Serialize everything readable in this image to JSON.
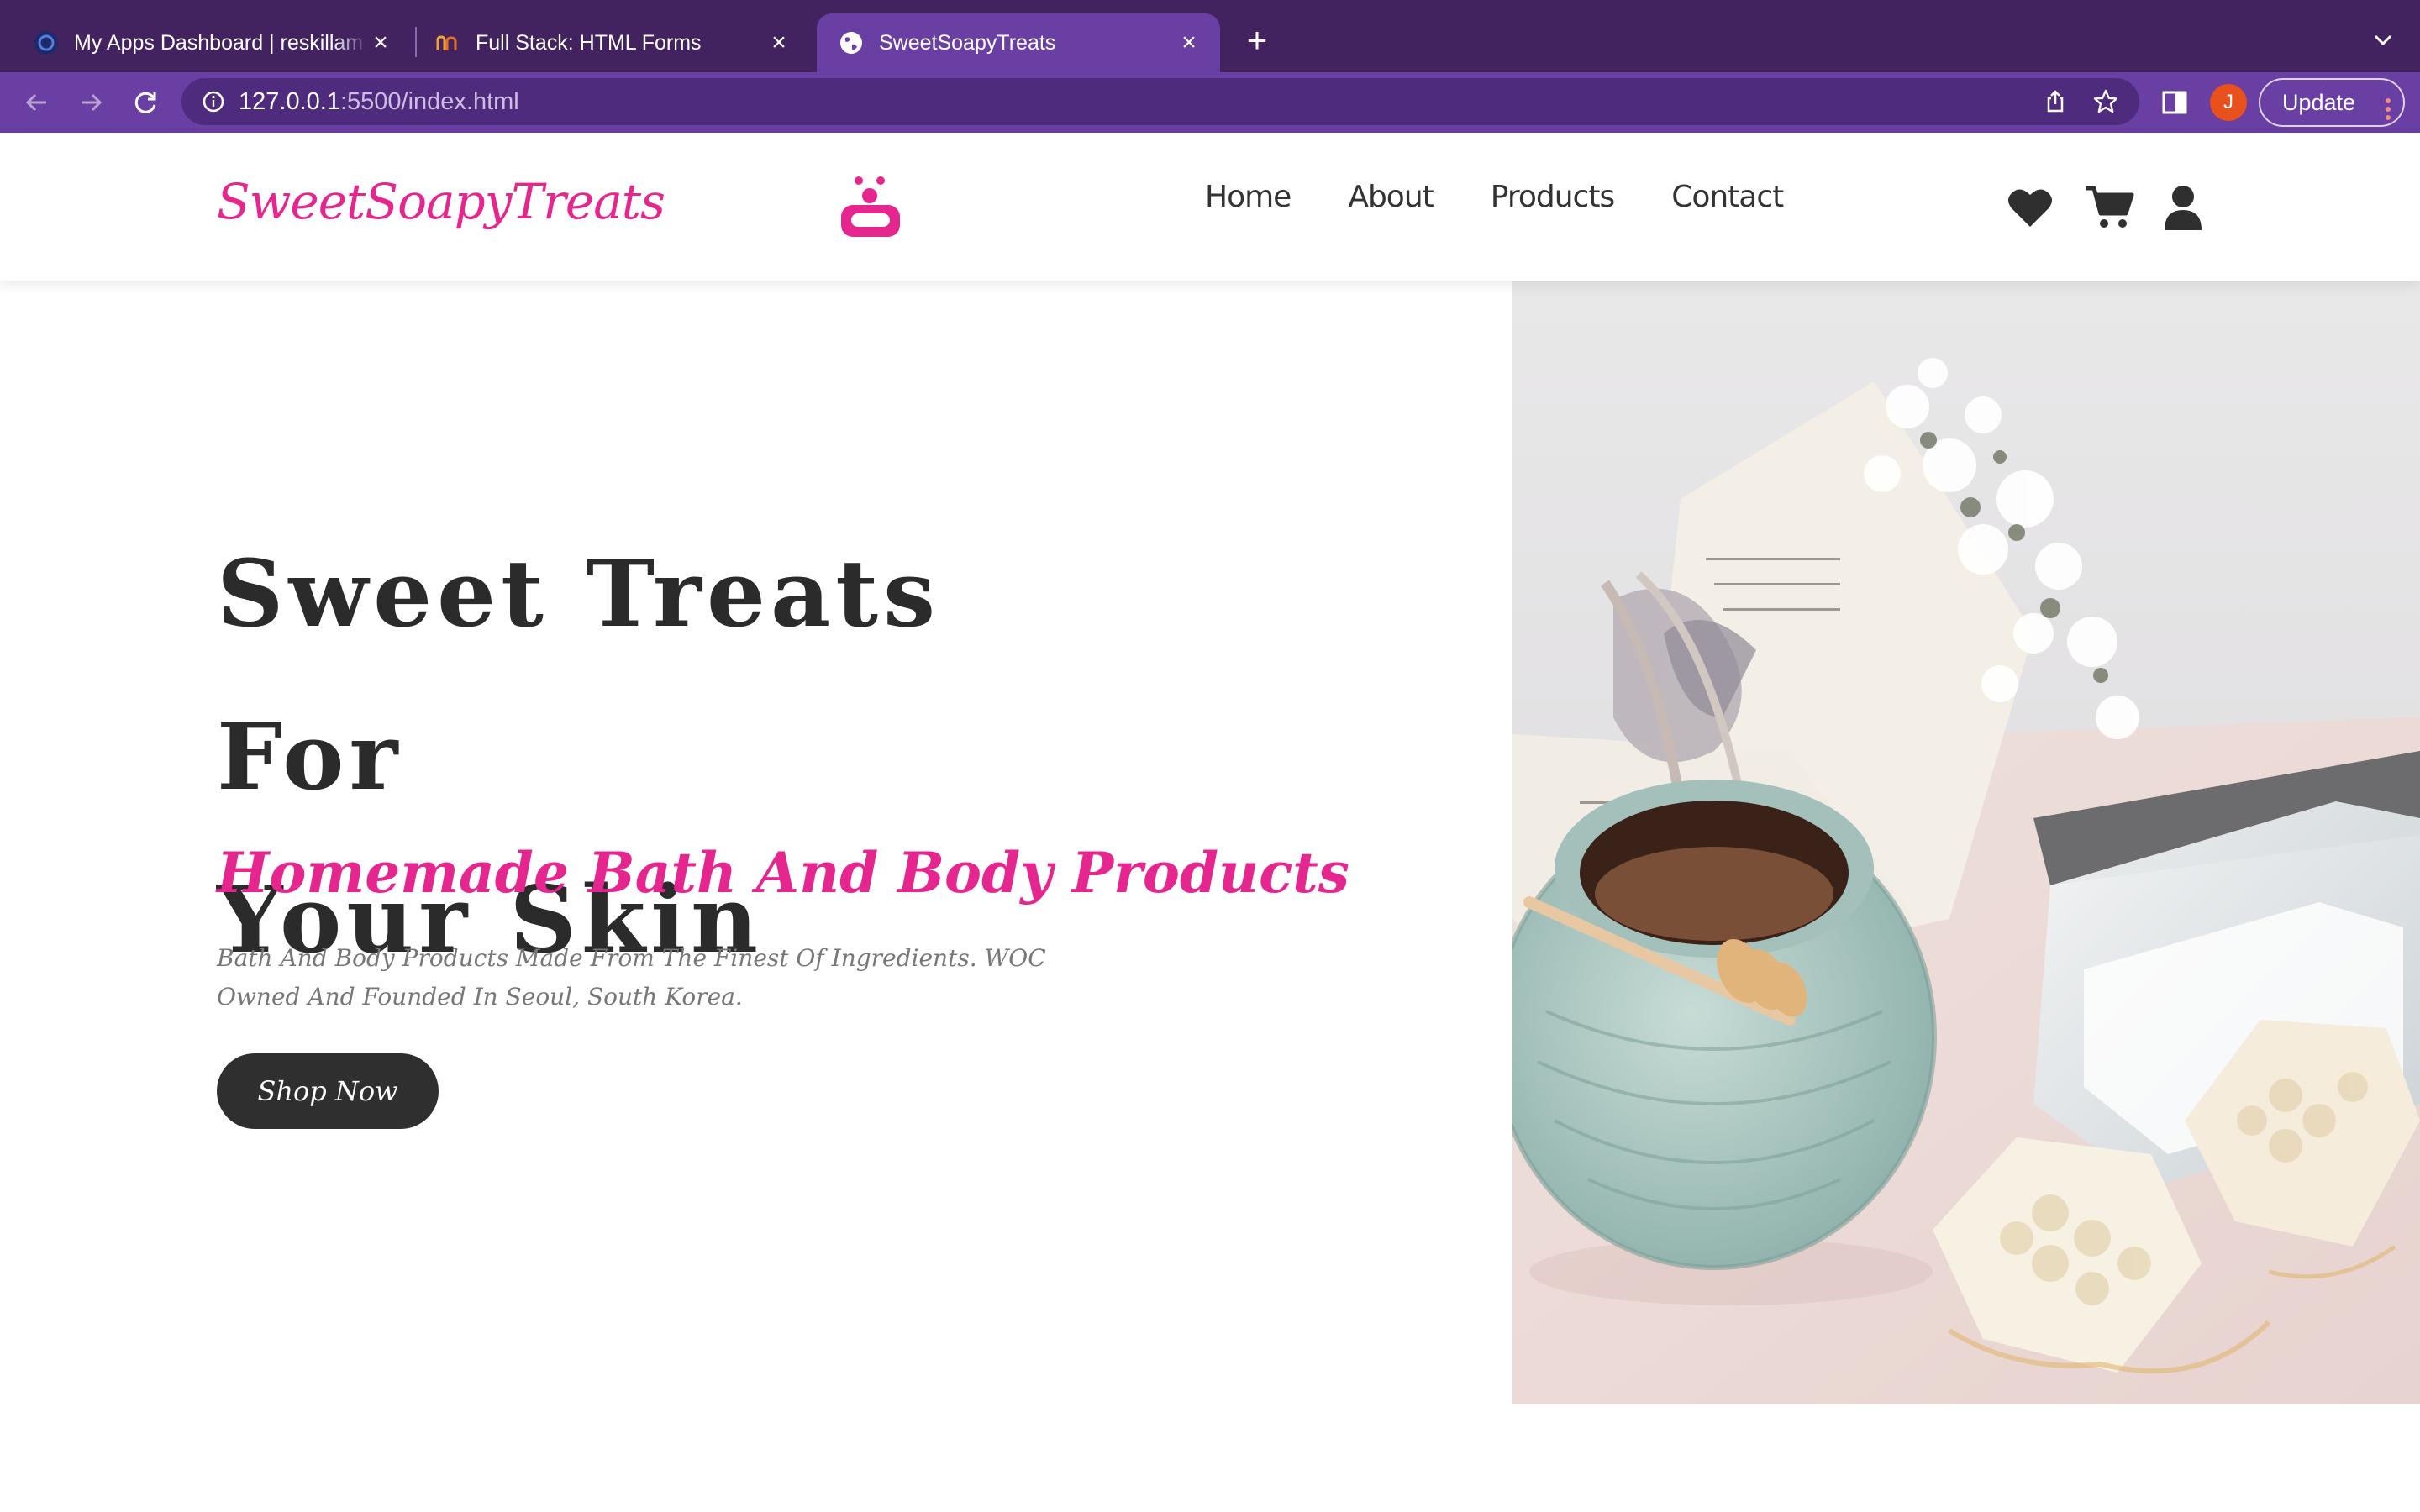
{
  "browser": {
    "tabs": [
      {
        "title": "My Apps Dashboard | reskillam",
        "close": "×"
      },
      {
        "title": "Full Stack: HTML Forms",
        "close": "×"
      },
      {
        "title": "SweetSoapyTreats",
        "close": "×"
      }
    ],
    "new_tab": "+",
    "url_host": "127.0.0.1",
    "url_rest": ":5500/index.html",
    "avatar_initial": "J",
    "update_label": "Update",
    "colors": {
      "tabbar": "#42235f",
      "toolbar": "#6a3fa3",
      "omnibox": "#4f2b7e"
    }
  },
  "site": {
    "logo": "SweetSoapyTreats",
    "nav": [
      "Home",
      "About",
      "Products",
      "Contact"
    ],
    "icons": [
      "heart-icon",
      "cart-icon",
      "user-icon"
    ],
    "accent_color": "#e6268f"
  },
  "hero": {
    "title_line1": "Sweet Treats For",
    "title_line2": "Your Skin",
    "subtitle": "Homemade Bath And Body Products",
    "description": "Bath And Body Products Made From The Finest Of Ingredients. WOC Owned And Founded In Seoul, South Korea.",
    "cta": "Shop Now"
  }
}
